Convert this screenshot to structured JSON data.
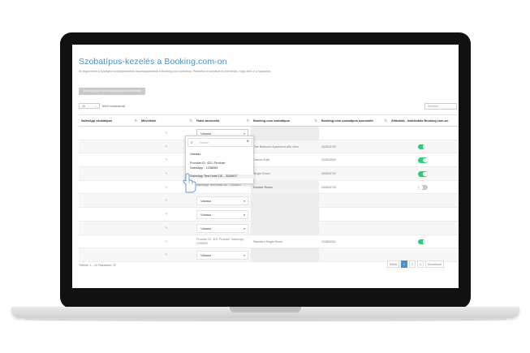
{
  "page": {
    "title": "Szobatípus-kezelés a Booking.com-on",
    "description": "Itt végezheted a Szamyno szobatípusainak összekapcsolását a Booking.com szobáival. Párosítsd a szobákat és ellenőrizd, hogy aktív-e a kapcsolat.",
    "connect_button": "Szobatípusok összekapcsolásának elindítása"
  },
  "controls": {
    "length_value": "10",
    "length_label": "tételt mutassanak",
    "search_placeholder": "Keresés"
  },
  "table": {
    "headers": [
      "SalesApp szobatípus",
      "Műveletek",
      "Hotel azonosító",
      "Booking.com szobatípus",
      "Booking.com szobatípus azonosító",
      "Aktiválás - Inaktiválás Booking.com-on"
    ],
    "rows": [
      {
        "edit": "✎",
        "hotel": "Válassz",
        "booking_room": "",
        "booking_id": "",
        "toggle": "none"
      },
      {
        "edit": "✎",
        "hotel": "",
        "booking_room": "One Bedroom Apartment with View",
        "booking_id": "332603702",
        "toggle": "on"
      },
      {
        "edit": "✎",
        "hotel": "",
        "booking_room": "Deluxe Suite",
        "booking_id": "332603004",
        "toggle": "on"
      },
      {
        "edit": "✎",
        "hotel": "",
        "booking_room": "Single Room",
        "booking_id": "332603702",
        "toggle": "on"
      },
      {
        "edit": "✎",
        "hotel": "SalesApp Test Hotel DE - 3326637",
        "booking_room": "Double Room",
        "booking_id": "332603703",
        "toggle": "off"
      },
      {
        "edit": "✎",
        "hotel": "Válassz",
        "booking_room": "",
        "booking_id": "",
        "toggle": "none"
      },
      {
        "edit": "✎",
        "hotel": "Válassz",
        "booking_room": "",
        "booking_id": "",
        "toggle": "none"
      },
      {
        "edit": "✎",
        "hotel": "Válassz",
        "booking_room": "",
        "booking_id": "",
        "toggle": "none"
      },
      {
        "edit": "✎",
        "hotel": "Provider ID: 420, Provider SalesApp - 1238063",
        "booking_room": "Standard Single Room",
        "booking_id": "123806301",
        "toggle": "on"
      },
      {
        "edit": "✎",
        "hotel": "Válassz",
        "booking_room": "",
        "booking_id": "",
        "toggle": "none"
      }
    ]
  },
  "footer": {
    "info": "Tételek: 1 - 10 Összesen: 22",
    "pager": [
      "Előző",
      "1",
      "2",
      "3",
      "Következő"
    ],
    "current_page": "1"
  },
  "dropdown": {
    "search_placeholder": "Search",
    "clear": "×",
    "options": [
      "Válassz",
      "Provider ID: 420, Provider",
      "SalesApp - 1238063",
      "SalesApp Test Hotel DE - 3326637"
    ]
  },
  "colors": {
    "accent": "#4a90c8",
    "toggle_on": "#2ecc71",
    "toggle_off": "#c8c8c8"
  }
}
